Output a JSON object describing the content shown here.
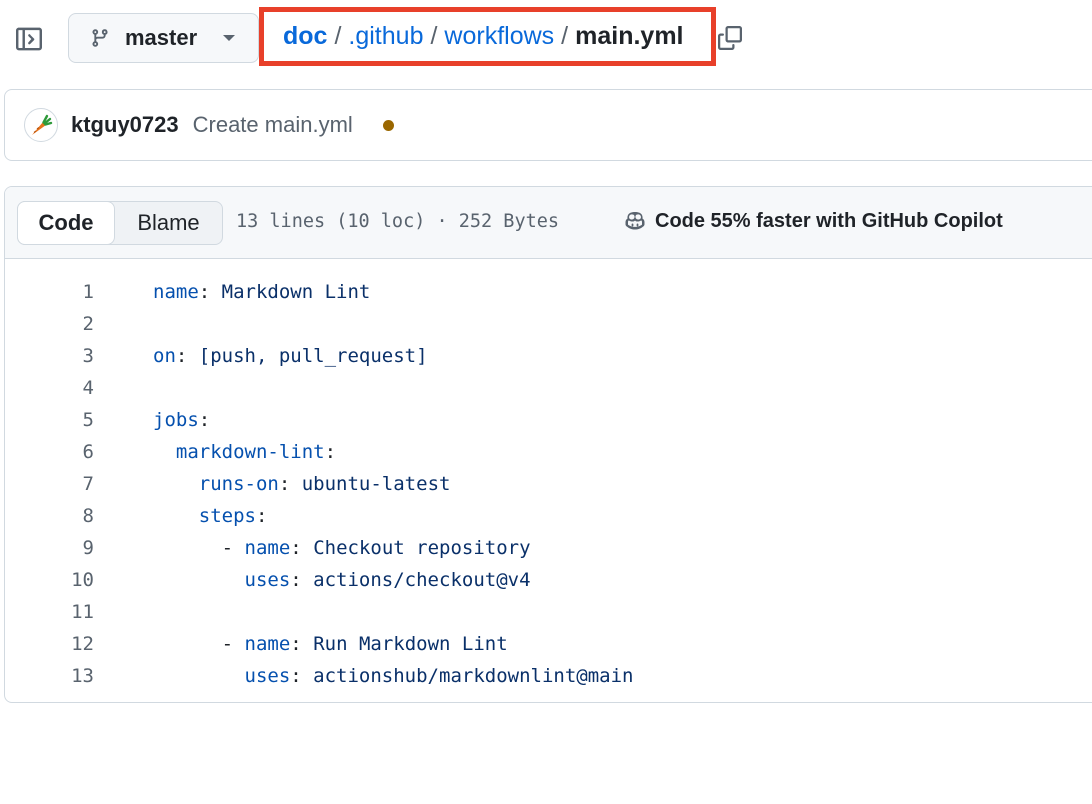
{
  "branch": {
    "name": "master"
  },
  "breadcrumb": {
    "root": "doc",
    "segments": [
      ".github",
      "workflows"
    ],
    "current": "main.yml",
    "separator": "/"
  },
  "commit": {
    "author": "ktguy0723",
    "message": "Create main.yml",
    "status_color": "#9a6700"
  },
  "file_header": {
    "tabs": {
      "code": "Code",
      "blame": "Blame"
    },
    "meta": "13 lines (10 loc) · 252 Bytes",
    "copilot": "Code 55% faster with GitHub Copilot"
  },
  "code_lines": [
    {
      "num": "1",
      "indent": "",
      "dash": "",
      "key": "name",
      "sep": ": ",
      "value": "Markdown Lint"
    },
    {
      "num": "2",
      "indent": "",
      "dash": "",
      "key": "",
      "sep": "",
      "value": ""
    },
    {
      "num": "3",
      "indent": "",
      "dash": "",
      "key": "on",
      "sep": ": ",
      "value": "[push, pull_request]"
    },
    {
      "num": "4",
      "indent": "",
      "dash": "",
      "key": "",
      "sep": "",
      "value": ""
    },
    {
      "num": "5",
      "indent": "",
      "dash": "",
      "key": "jobs",
      "sep": ":",
      "value": ""
    },
    {
      "num": "6",
      "indent": "  ",
      "dash": "",
      "key": "markdown-lint",
      "sep": ":",
      "value": ""
    },
    {
      "num": "7",
      "indent": "    ",
      "dash": "",
      "key": "runs-on",
      "sep": ": ",
      "value": "ubuntu-latest"
    },
    {
      "num": "8",
      "indent": "    ",
      "dash": "",
      "key": "steps",
      "sep": ":",
      "value": ""
    },
    {
      "num": "9",
      "indent": "      ",
      "dash": "- ",
      "key": "name",
      "sep": ": ",
      "value": "Checkout repository"
    },
    {
      "num": "10",
      "indent": "        ",
      "dash": "",
      "key": "uses",
      "sep": ": ",
      "value": "actions/checkout@v4"
    },
    {
      "num": "11",
      "indent": "",
      "dash": "",
      "key": "",
      "sep": "",
      "value": ""
    },
    {
      "num": "12",
      "indent": "      ",
      "dash": "- ",
      "key": "name",
      "sep": ": ",
      "value": "Run Markdown Lint"
    },
    {
      "num": "13",
      "indent": "        ",
      "dash": "",
      "key": "uses",
      "sep": ": ",
      "value": "actionshub/markdownlint@main"
    }
  ]
}
